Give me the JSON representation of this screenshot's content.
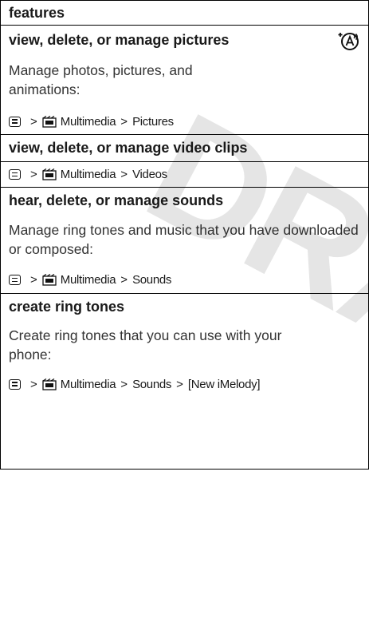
{
  "header": {
    "title": "features"
  },
  "watermark": {
    "text": "DRAFT"
  },
  "icons": {
    "menu_key": "menu-key-icon",
    "multimedia": "multimedia-icon",
    "network": "network-service-icon"
  },
  "sections": [
    {
      "title": "view, delete, or manage pictures",
      "description": "Manage photos, pictures, and animations:",
      "path": [
        "Multimedia",
        "Pictures"
      ]
    },
    {
      "title": "view, delete, or manage video clips",
      "path": [
        "Multimedia",
        "Videos"
      ]
    },
    {
      "title": "hear, delete, or manage sounds",
      "description": "Manage ring tones and music that you have downloaded or composed:",
      "path": [
        "Multimedia",
        "Sounds"
      ]
    },
    {
      "title": "create ring tones",
      "description": "Create ring tones that you can use with your phone:",
      "path": [
        "Multimedia",
        "Sounds",
        "[New iMelody]"
      ]
    }
  ],
  "separator": ">"
}
